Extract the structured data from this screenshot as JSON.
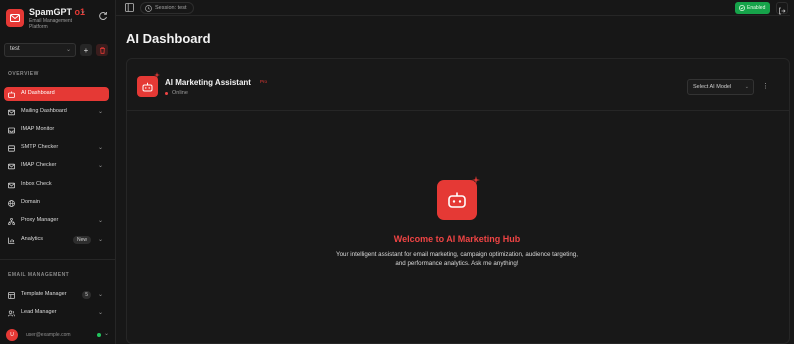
{
  "sidebar": {
    "brand": {
      "name": "SpamGPT",
      "version": "o1",
      "subtitle": "Email Management Platform"
    },
    "project": {
      "value": "test"
    },
    "sections": {
      "overview": "OVERVIEW",
      "email_management": "EMAIL MANAGEMENT"
    },
    "items": [
      {
        "label": "AI Dashboard",
        "icon": "bot-icon",
        "active": true
      },
      {
        "label": "Mailing Dashboard",
        "icon": "mail-icon",
        "chevron": true
      },
      {
        "label": "IMAP Monitor",
        "icon": "inbox-icon"
      },
      {
        "label": "SMTP Checker",
        "icon": "server-icon",
        "chevron": true
      },
      {
        "label": "IMAP Checker",
        "icon": "mail-check-icon",
        "chevron": true
      },
      {
        "label": "Inbox Check",
        "icon": "mail-icon"
      },
      {
        "label": "Domain",
        "icon": "globe-icon"
      },
      {
        "label": "Proxy Manager",
        "icon": "network-icon",
        "chevron": true
      },
      {
        "label": "Analytics",
        "icon": "chart-icon",
        "badge": "New",
        "chevron": true
      }
    ],
    "email_items": [
      {
        "label": "Template Manager",
        "icon": "template-icon",
        "badge": "5",
        "chevron": true
      },
      {
        "label": "Lead Manager",
        "icon": "users-icon",
        "chevron": true
      }
    ],
    "user": {
      "initials": "U",
      "email": "user@example.com"
    }
  },
  "topbar": {
    "session": "Session: test",
    "status": "Enabled"
  },
  "main": {
    "title": "AI Dashboard"
  },
  "assistant": {
    "name": "AI Marketing Assistant",
    "tag": "Pro",
    "status": "Online",
    "model_placeholder": "Select AI Model"
  },
  "welcome": {
    "title": "Welcome to AI Marketing Hub",
    "body": "Your intelligent assistant for email marketing, campaign optimization, audience targeting, and performance analytics. Ask me anything!"
  },
  "colors": {
    "accent": "#e53935",
    "success": "#16a34a",
    "bg": "#171717"
  }
}
